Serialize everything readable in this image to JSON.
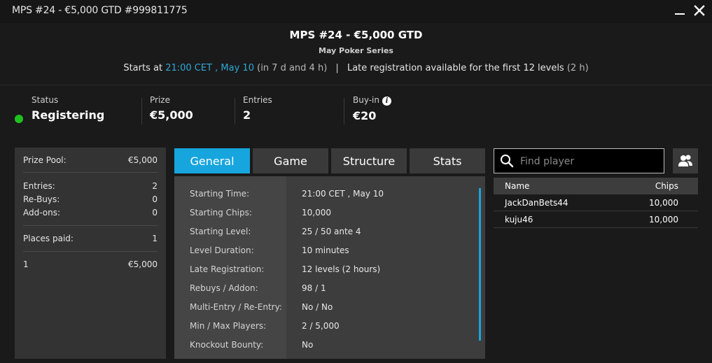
{
  "window": {
    "title": "MPS #24 - €5,000 GTD #999811775"
  },
  "header": {
    "title": "MPS #24 - €5,000 GTD",
    "subtitle": "May Poker Series",
    "starts_prefix": "Starts at",
    "starts_time": "21:00 CET , May 10",
    "starts_relative": "(in 7 d and 4 h)",
    "separator": "|",
    "late_reg_text": "Late registration available for the first 12 levels",
    "late_reg_duration": "(2 h)"
  },
  "summary": {
    "status": {
      "label": "Status",
      "value": "Registering",
      "color": "#1fc11f"
    },
    "prize": {
      "label": "Prize",
      "value": "€5,000"
    },
    "entries": {
      "label": "Entries",
      "value": "2"
    },
    "buyin": {
      "label": "Buy-in",
      "value": "€20",
      "info_icon": "i"
    }
  },
  "prize_panel": {
    "prize_pool_label": "Prize Pool:",
    "prize_pool_value": "€5,000",
    "entries_label": "Entries:",
    "entries_value": "2",
    "rebuys_label": "Re-Buys:",
    "rebuys_value": "0",
    "addons_label": "Add-ons:",
    "addons_value": "0",
    "places_paid_label": "Places paid:",
    "places_paid_value": "1",
    "payouts": [
      {
        "place": "1",
        "amount": "€5,000"
      }
    ]
  },
  "tabs": [
    {
      "label": "General",
      "active": true
    },
    {
      "label": "Game",
      "active": false
    },
    {
      "label": "Structure",
      "active": false
    },
    {
      "label": "Stats",
      "active": false
    }
  ],
  "general": [
    {
      "key": "Starting Time:",
      "value": "21:00 CET , May 10"
    },
    {
      "key": "Starting Chips:",
      "value": "10,000"
    },
    {
      "key": "Starting Level:",
      "value": "25 / 50 ante 4"
    },
    {
      "key": "Level Duration:",
      "value": "10 minutes"
    },
    {
      "key": "Late Registration:",
      "value": "12 levels (2 hours)"
    },
    {
      "key": "Rebuys / Addon:",
      "value": "98 / 1"
    },
    {
      "key": "Multi-Entry / Re-Entry:",
      "value": "No / No"
    },
    {
      "key": "Min / Max Players:",
      "value": "2 / 5,000"
    },
    {
      "key": "Knockout Bounty:",
      "value": "No"
    }
  ],
  "search": {
    "placeholder": "Find player"
  },
  "players": {
    "col_name": "Name",
    "col_chips": "Chips",
    "rows": [
      {
        "name": "JackDanBets44",
        "chips": "10,000"
      },
      {
        "name": "kuju46",
        "chips": "10,000"
      }
    ]
  },
  "colors": {
    "accent": "#17a5dd",
    "link_blue": "#2fa8d8",
    "status_green": "#1fc11f"
  }
}
